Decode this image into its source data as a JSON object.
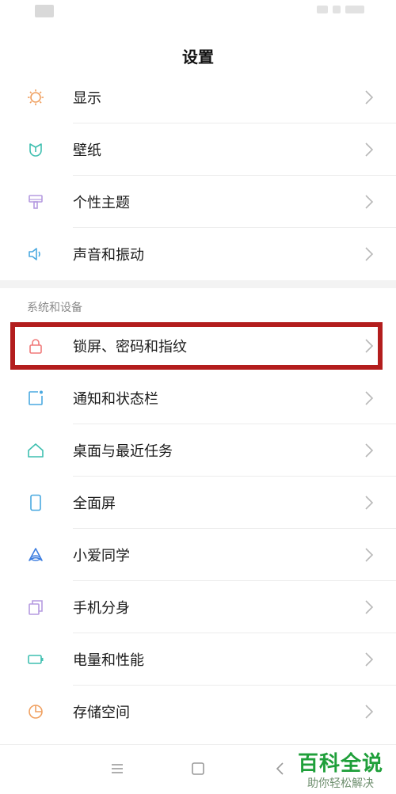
{
  "header": {
    "title": "设置"
  },
  "section_display": {
    "items": [
      {
        "label": "显示",
        "icon": "sun-icon",
        "color": "#f0a060"
      },
      {
        "label": "壁纸",
        "icon": "tulip-icon",
        "color": "#3fbfb0"
      },
      {
        "label": "个性主题",
        "icon": "paint-roller-icon",
        "color": "#b59be0"
      },
      {
        "label": "声音和振动",
        "icon": "speaker-icon",
        "color": "#4aa9e0"
      }
    ]
  },
  "section_system": {
    "title": "系统和设备",
    "items": [
      {
        "label": "锁屏、密码和指纹",
        "icon": "lock-icon",
        "color": "#f07a7a"
      },
      {
        "label": "通知和状态栏",
        "icon": "notification-icon",
        "color": "#4aa9e0"
      },
      {
        "label": "桌面与最近任务",
        "icon": "home-icon",
        "color": "#3fbfb0"
      },
      {
        "label": "全面屏",
        "icon": "phone-icon",
        "color": "#4aa9e0"
      },
      {
        "label": "小爱同学",
        "icon": "xiaoai-icon",
        "color": "#3f7fe0"
      },
      {
        "label": "手机分身",
        "icon": "clone-icon",
        "color": "#b59be0"
      },
      {
        "label": "电量和性能",
        "icon": "battery-icon",
        "color": "#3fbfb0"
      },
      {
        "label": "存储空间",
        "icon": "pie-chart-icon",
        "color": "#f0a060"
      }
    ]
  },
  "highlight_color": "#b31d1d",
  "watermark": {
    "title": "百科全说",
    "subtitle": "助你轻松解决"
  }
}
